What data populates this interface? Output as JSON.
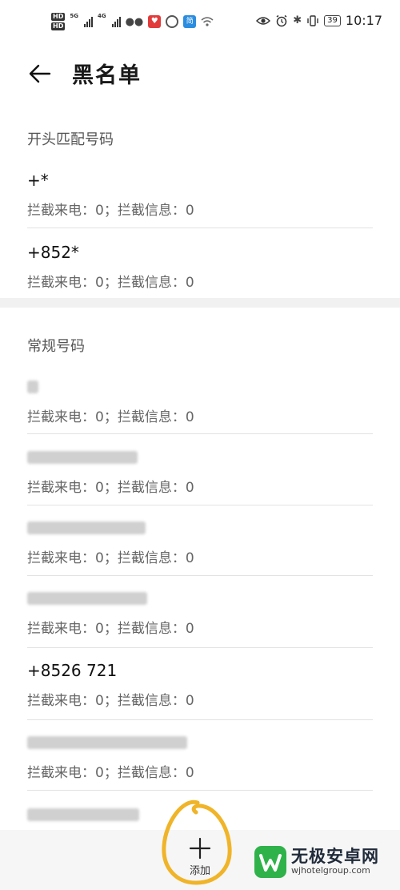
{
  "status_bar": {
    "time": "10:17",
    "battery": "39",
    "network_1": "5G",
    "network_2": "4G",
    "hd_label": "HD",
    "app_blue_glyph": "简"
  },
  "header": {
    "title": "黑名单"
  },
  "sections": {
    "prefix": {
      "title": "开头匹配号码",
      "items": [
        {
          "number": "+*",
          "meta": "拦截来电：0；拦截信息：0"
        },
        {
          "number": "+852*",
          "meta": "拦截来电：0；拦截信息：0"
        }
      ]
    },
    "regular": {
      "title": "常规号码",
      "items": [
        {
          "meta": "拦截来电：0；拦截信息：0"
        },
        {
          "meta": "拦截来电：0；拦截信息：0"
        },
        {
          "meta": "拦截来电：0；拦截信息：0"
        },
        {
          "meta": "拦截来电：0；拦截信息：0"
        },
        {
          "number": "+8526 721",
          "meta": "拦截来电：0；拦截信息：0"
        },
        {
          "meta": "拦截来电：0；拦截信息：0"
        }
      ]
    }
  },
  "bottom_bar": {
    "add_label": "添加"
  },
  "watermark": {
    "name": "无极安卓网",
    "url": "wjhotelgroup.com"
  },
  "colors": {
    "highlight": "#f0b429",
    "watermark_green": "#2fb24a"
  }
}
